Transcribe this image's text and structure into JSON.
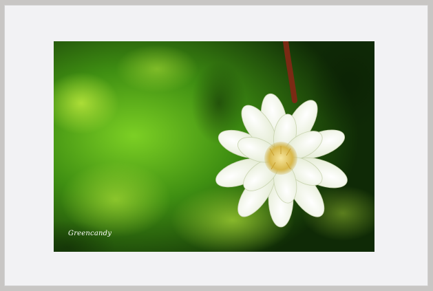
{
  "photo": {
    "watermark": "Greencandy"
  },
  "colors": {
    "outer_background": "#c8c6c4",
    "frame_background": "#f2f2f4",
    "foliage_dark": "#0f2a06",
    "foliage_bright": "#7ccf24",
    "petal": "#f4f6ee",
    "stem": "#7a2a14",
    "flower_center": "#e8d27a"
  }
}
